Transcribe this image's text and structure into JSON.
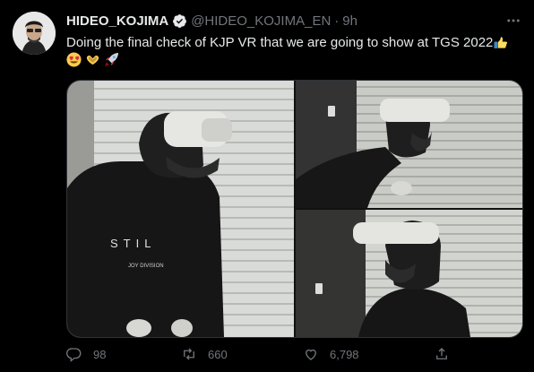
{
  "author": {
    "name": "HIDEO_KOJIMA",
    "handle": "@HIDEO_KOJIMA_EN",
    "separator": "·",
    "time": "9h"
  },
  "tweet": {
    "text": "Doing the final check of KJP VR that we are going to show at TGS 2022",
    "shirt_text_1": "STIL",
    "shirt_text_2": "JOY DIVISION"
  },
  "actions": {
    "replies": "98",
    "retweets": "660",
    "likes": "6,798"
  },
  "colors": {
    "background": "#000000",
    "text": "#e7e9ea",
    "muted": "#71767b",
    "verified": "#1d9bf0",
    "border": "#2f3336"
  },
  "icons": [
    "verified-badge-icon",
    "more-icon",
    "thumbs-up-emoji",
    "heart-eyes-emoji",
    "hands-heart-emoji",
    "rocket-emoji",
    "reply-icon",
    "retweet-icon",
    "like-icon",
    "share-icon"
  ]
}
